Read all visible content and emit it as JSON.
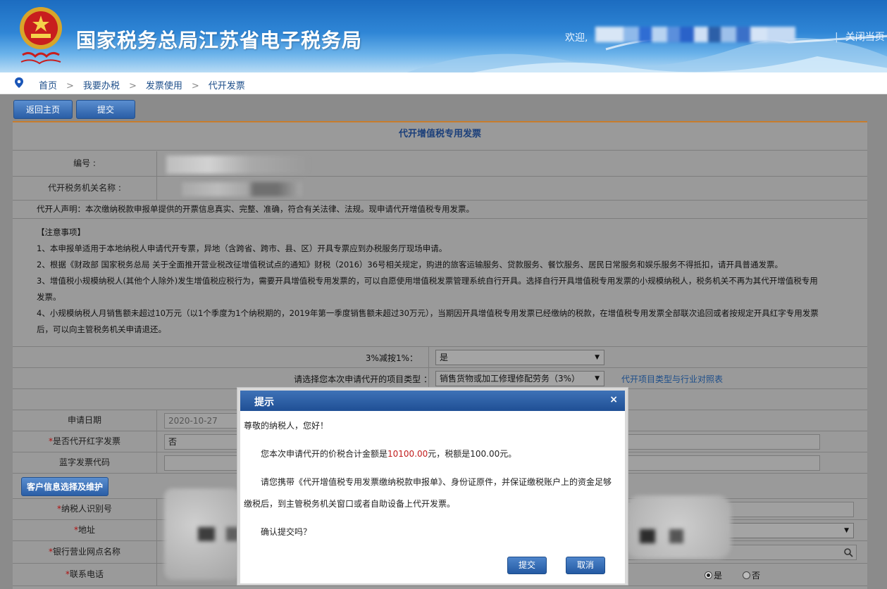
{
  "header": {
    "site_title": "国家税务总局江苏省电子税务局",
    "welcome": "欢迎,",
    "close_link": "关闭当页"
  },
  "breadcrumb": [
    "首页",
    "我要办税",
    "发票使用",
    "代开发票"
  ],
  "toolbar": {
    "back_label": "返回主页",
    "submit_label": "提交"
  },
  "form": {
    "title": "代开增值税专用发票",
    "number_label": "编号 :",
    "office_label": "代开税务机关名称 :",
    "declaration": "代开人声明：本次缴纳税款申报单提供的开票信息真实、完整、准确，符合有关法律、法规。现申请代开增值税专用发票。",
    "notice_title": "【注意事项】",
    "notice_1": "1、本申报单适用于本地纳税人申请代开专票，异地（含跨省、跨市、县、区）开具专票应到办税服务厅现场申请。",
    "notice_2": "2、根据《财政部 国家税务总局 关于全面推开营业税改征增值税试点的通知》财税（2016）36号相关规定，购进的旅客运输服务、贷款服务、餐饮服务、居民日常服务和娱乐服务不得抵扣，请开具普通发票。",
    "notice_3a": "3、增值税小规模纳税人(其他个人除外)发生增值税应税行为，需要开具增值税专用发票的，可以自愿使用增值税发票管理系统自行开具。选择自行开具增值税专用发票的小规模纳税人，税务机关不再为其代开增值税专用",
    "notice_3b": "发票。",
    "notice_4a": "4、小规模纳税人月销售额未超过10万元（以1个季度为1个纳税期的，2019年第一季度销售额未超过30万元），当期因开具增值税专用发票已经缴纳的税款，在增值税专用发票全部联次追回或者按规定开具红字专用发票",
    "notice_4b": "后，可以向主管税务机关申请退还。",
    "reduce_label": "3%减按1%：",
    "reduce_value": "是",
    "type_label": "请选择您本次申请代开的项目类型 ：",
    "type_value": "销售货物或加工修理修配劳务（3%）",
    "type_link": "代开项目类型与行业对照表",
    "apply_date_label": "申请日期",
    "apply_date_value": "2020-10-27",
    "red_label": "是否代开红字发票",
    "red_value": "否",
    "blue_code_label": "蓝字发票代码",
    "customer_btn": "客户信息选择及维护",
    "taxpayer_id_label": "纳税人识别号",
    "address_label": "地址",
    "bank_label": "银行营业网点名称",
    "phone_label": "联系电话",
    "radio_yes": "是",
    "radio_no": "否",
    "required_mark": "*"
  },
  "modal": {
    "title": "提示",
    "close": "×",
    "greeting": "尊敬的纳税人，您好！",
    "line1_pre": "您本次申请代开的价税合计金额是",
    "total_amount": "10100.00",
    "line1_mid": "元，税额是100.00元。",
    "line2a": "请您携带《代开增值税专用发票缴纳税款申报单》、身份证原件，并保证缴税账户上的资金足够",
    "line2b": "缴税后，到主管税务机关窗口或者自助设备上代开发票。",
    "confirm": "确认提交吗？",
    "submit_label": "提交",
    "cancel_label": "取消"
  },
  "colors": {
    "accent": "#2a5ea6",
    "amount": "#c11b1b",
    "panel_border": "#c77d2e"
  }
}
